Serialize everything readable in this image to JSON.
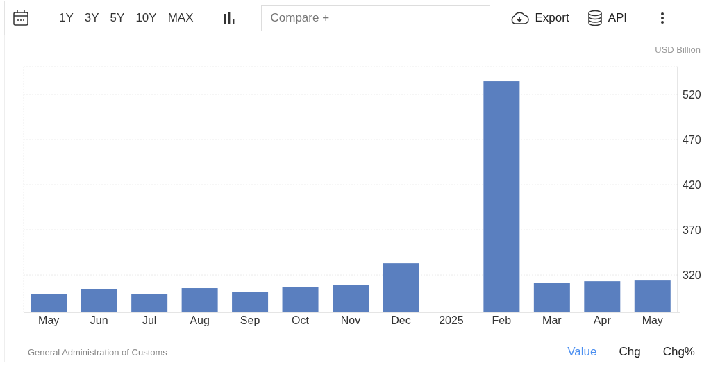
{
  "toolbar": {
    "ranges": [
      "1Y",
      "3Y",
      "5Y",
      "10Y",
      "MAX"
    ],
    "compare": {
      "placeholder": "Compare +"
    },
    "export": "Export",
    "api": "API"
  },
  "chart": {
    "unit": "USD Billion",
    "chart_data": {
      "type": "bar",
      "categories": [
        "May",
        "Jun",
        "Jul",
        "Aug",
        "Sep",
        "Oct",
        "Nov",
        "Dec",
        "2025",
        "Feb",
        "Mar",
        "Apr",
        "May"
      ],
      "values": [
        299,
        304.6,
        298.5,
        305.4,
        300.8,
        306.9,
        309.2,
        333,
        null,
        534.6,
        310.8,
        313,
        313.8
      ],
      "grid": true,
      "ylim": [
        278.5,
        550.8
      ],
      "yticks": [
        320,
        370,
        420,
        470,
        520
      ]
    }
  },
  "footer": {
    "source": "General Administration of Customs",
    "tabs": [
      {
        "label": "Value",
        "selected": true
      },
      {
        "label": "Chg",
        "selected": false
      },
      {
        "label": "Chg%",
        "selected": false
      }
    ]
  }
}
